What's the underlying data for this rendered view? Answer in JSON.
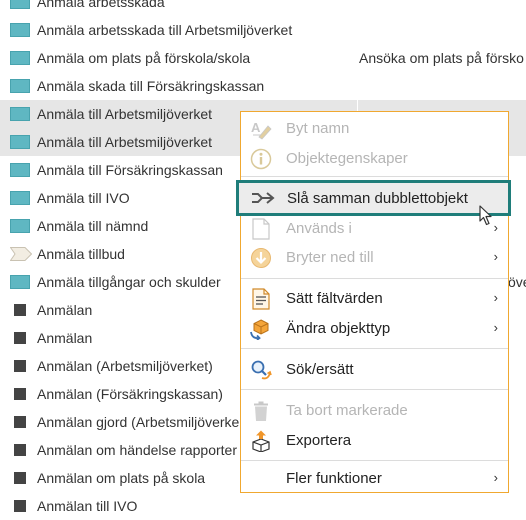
{
  "tree": {
    "rows": [
      {
        "icon": "teal-folder-icon",
        "label": "Anmäla arbetsskada",
        "label2": ""
      },
      {
        "icon": "teal-folder-icon",
        "label": "Anmäla arbetsskada till Arbetsmiljöverket",
        "label2": ""
      },
      {
        "icon": "teal-folder-icon",
        "label": "Anmäla om plats på förskola/skola",
        "label2": "Ansöka om plats på försko"
      },
      {
        "icon": "teal-folder-icon",
        "label": "Anmäla skada till Försäkringskassan",
        "label2": ""
      },
      {
        "icon": "teal-folder-icon",
        "label": "Anmäla till Arbetsmiljöverket",
        "label2": "",
        "selected": true
      },
      {
        "icon": "teal-folder-icon",
        "label": "Anmäla till Arbetsmiljöverket",
        "label2": "",
        "selected": true
      },
      {
        "icon": "teal-folder-icon",
        "label": "Anmäla till Försäkringskassan",
        "label2": ""
      },
      {
        "icon": "teal-folder-icon",
        "label": "Anmäla till IVO",
        "label2": ""
      },
      {
        "icon": "teal-folder-icon",
        "label": "Anmäla till nämnd",
        "label2": ""
      },
      {
        "icon": "tag-icon",
        "label": "Anmäla tillbud",
        "label2": ""
      },
      {
        "icon": "teal-folder-icon",
        "label": "Anmäla tillgångar och skulder",
        "label2": "öve"
      },
      {
        "icon": "black-square-icon",
        "label": "Anmälan",
        "label2": ""
      },
      {
        "icon": "black-square-icon",
        "label": "Anmälan",
        "label2": ""
      },
      {
        "icon": "black-square-icon",
        "label": "Anmälan (Arbetsmiljöverket)",
        "label2": ""
      },
      {
        "icon": "black-square-icon",
        "label": "Anmälan (Försäkringskassan)",
        "label2": ""
      },
      {
        "icon": "black-square-icon",
        "label": "Anmälan gjord (Arbetsmiljöverke",
        "label2": ""
      },
      {
        "icon": "black-square-icon",
        "label": "Anmälan om händelse rapporter",
        "label2": ""
      },
      {
        "icon": "black-square-icon",
        "label": "Anmälan om plats på skola",
        "label2": ""
      },
      {
        "icon": "black-square-icon",
        "label": "Anmälan till IVO",
        "label2": ""
      }
    ]
  },
  "context_menu": {
    "items": [
      {
        "label": "Byt namn",
        "icon": "rename-icon",
        "disabled": true,
        "submenu": false
      },
      {
        "label": "Objektegenskaper",
        "icon": "info-icon",
        "disabled": true,
        "submenu": false
      },
      {
        "label": "Slå samman dubblettobjekt",
        "icon": "merge-icon",
        "disabled": false,
        "submenu": false,
        "highlighted": true
      },
      {
        "label": "Används i",
        "icon": "document-icon",
        "disabled": true,
        "submenu": true
      },
      {
        "label": "Bryter ned till",
        "icon": "breakdown-icon",
        "disabled": true,
        "submenu": true
      },
      {
        "label": "Sätt fältvärden",
        "icon": "field-values-icon",
        "disabled": false,
        "submenu": true
      },
      {
        "label": "Ändra objekttyp",
        "icon": "change-type-icon",
        "disabled": false,
        "submenu": true
      },
      {
        "label": "Sök/ersätt",
        "icon": "search-replace-icon",
        "disabled": false,
        "submenu": false
      },
      {
        "label": "Ta bort markerade",
        "icon": "trash-icon",
        "disabled": true,
        "submenu": false
      },
      {
        "label": "Exportera",
        "icon": "export-icon",
        "disabled": false,
        "submenu": false
      },
      {
        "label": "Fler funktioner",
        "icon": "",
        "disabled": false,
        "submenu": true
      }
    ],
    "submenu_arrow": "›"
  },
  "colors": {
    "accent_border": "#f0a830",
    "highlight_outline": "#1f7d7a",
    "folder_teal": "#5fb7c2",
    "selection_bg": "#e6e6e6"
  }
}
